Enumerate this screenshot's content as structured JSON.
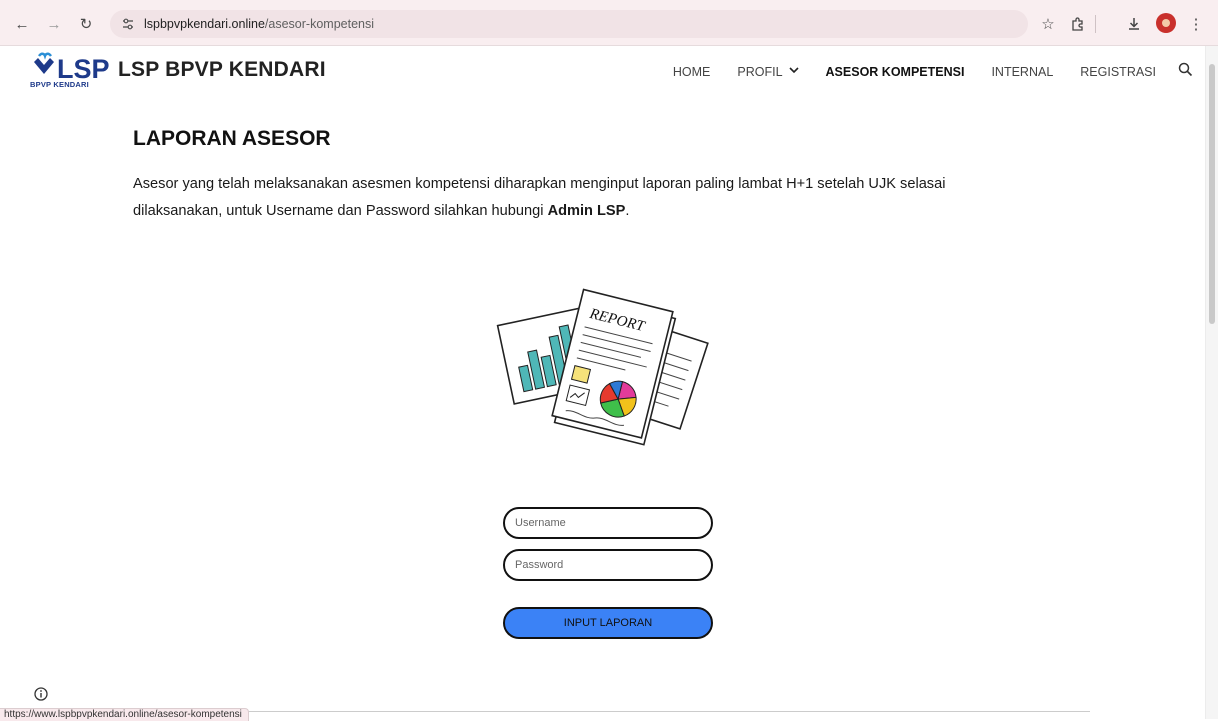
{
  "browser": {
    "url_host": "lspbpvpkendari.online",
    "url_path": "/asesor-kompetensi",
    "status_url": "https://www.lspbpvpkendari.online/asesor-kompetensi"
  },
  "header": {
    "logo_text": "LSP",
    "logo_sub": "BPVP KENDARI",
    "brand": "LSP BPVP KENDARI",
    "menu": {
      "home": "HOME",
      "profil": "PROFIL",
      "asesor": "ASESOR KOMPETENSI",
      "internal": "INTERNAL",
      "registrasi": "REGISTRASI"
    }
  },
  "main": {
    "title": "LAPORAN ASESOR",
    "intro_part1": "Asesor yang telah melaksanakan asesmen kompetensi diharapkan menginput laporan paling lambat H+1 setelah UJK selasai dilaksanakan, untuk Username dan Password silahkan hubungi ",
    "intro_bold": "Admin LSP",
    "intro_end": ".",
    "illustration_label": "REPORT"
  },
  "form": {
    "username_placeholder": "Username",
    "password_placeholder": "Password",
    "submit_label": "INPUT LAPORAN"
  },
  "colors": {
    "accent_button": "#3b82f6",
    "logo_blue": "#1e3a8a"
  }
}
